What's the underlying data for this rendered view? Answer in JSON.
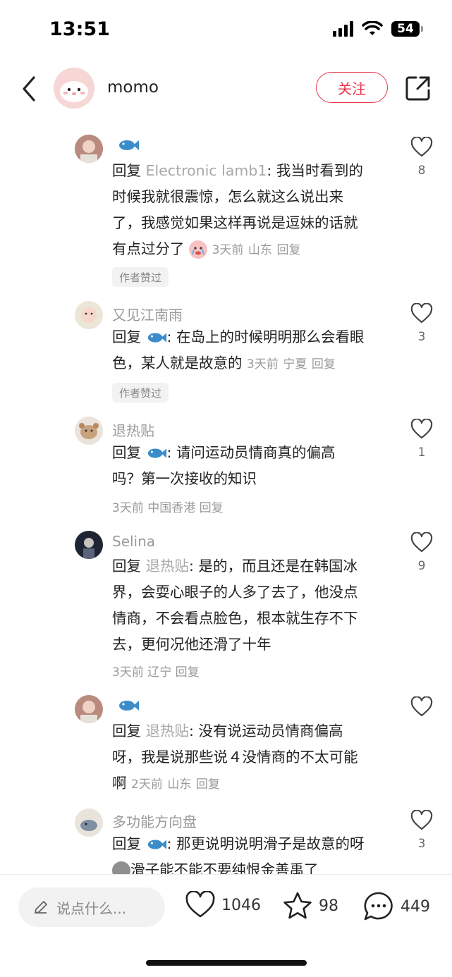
{
  "status": {
    "time": "13:51",
    "battery": "54"
  },
  "header": {
    "username": "momo",
    "follow_label": "关注"
  },
  "comments": [
    {
      "name": "",
      "reply_prefix": "回复 ",
      "reply_to": "Electronic lamb1",
      "text_line1": ": 我当时看到的",
      "text_line2": "时候我就很震惊，怎么就这么说出来",
      "text_line3": "了，我感觉如果这样再说是逗妹的话就",
      "text_line4": "有点过分了",
      "time": "3天前",
      "location": "山东",
      "reply_label": "回复",
      "likes": "8",
      "badge": "作者赞过"
    },
    {
      "name": "又见江南雨",
      "reply_prefix": "回复 ",
      "text_line1": ": 在岛上的时候明明那么会看眼",
      "text_line2": "色，某人就是故意的",
      "time": "3天前",
      "location": "宁夏",
      "reply_label": "回复",
      "likes": "3",
      "badge": "作者赞过"
    },
    {
      "name": "退热贴",
      "reply_prefix": "回复 ",
      "text_line1": ": 请问运动员情商真的偏高",
      "text_line2": "吗？第一次接收的知识",
      "time": "3天前",
      "location": "中国香港",
      "reply_label": "回复",
      "likes": "1"
    },
    {
      "name": "Selina",
      "reply_prefix": "回复 ",
      "reply_to": "退热贴",
      "text_line1": ": 是的，而且还是在韩国冰",
      "text_line2": "界，会耍心眼子的人多了去了，他没点",
      "text_line3": "情商，不会看点脸色，根本就生存不下",
      "text_line4": "去，更何况他还滑了十年",
      "time": "3天前",
      "location": "辽宁",
      "reply_label": "回复",
      "likes": "9"
    },
    {
      "name": "",
      "reply_prefix": "回复 ",
      "reply_to": "退热贴",
      "text_line1": ": 没有说运动员情商偏高",
      "text_line2": "呀，我是说那些说４没情商的不太可能",
      "text_line3": "啊",
      "time": "2天前",
      "location": "山东",
      "reply_label": "回复",
      "likes": ""
    },
    {
      "name": "多功能方向盘",
      "reply_prefix": "回复 ",
      "text_line1": ": 那更说明说明滑子是故意的呀",
      "text_line2": "滑子能不能不要纯恨金善禹了",
      "likes": "3"
    }
  ],
  "bottom": {
    "input_placeholder": "说点什么...",
    "likes": "1046",
    "stars": "98",
    "comments": "449"
  },
  "colors": {
    "accent": "#e8354a",
    "muted": "#9a9a9a"
  }
}
